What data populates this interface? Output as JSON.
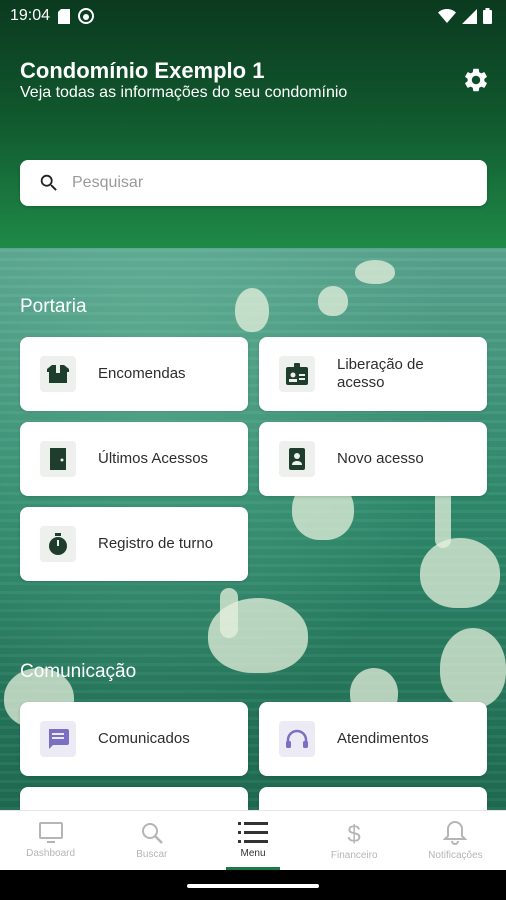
{
  "status_bar": {
    "time": "19:04"
  },
  "header": {
    "title": "Condomínio Exemplo 1",
    "subtitle": "Veja todas as informações do seu condomínio"
  },
  "search": {
    "placeholder": "Pesquisar"
  },
  "sections": {
    "portaria": {
      "title": "Portaria",
      "items": [
        {
          "label": "Encomendas",
          "icon": "package-icon"
        },
        {
          "label": "Liberação de acesso",
          "icon": "id-card-icon"
        },
        {
          "label": "Últimos Acessos",
          "icon": "door-icon"
        },
        {
          "label": "Novo acesso",
          "icon": "badge-icon"
        },
        {
          "label": "Registro de turno",
          "icon": "stopwatch-icon"
        }
      ]
    },
    "comunicacao": {
      "title": "Comunicação",
      "items": [
        {
          "label": "Comunicados",
          "icon": "message-icon"
        },
        {
          "label": "Atendimentos",
          "icon": "headset-icon"
        }
      ]
    }
  },
  "bottom_nav": {
    "items": [
      {
        "label": "Dashboard",
        "icon": "monitor-icon"
      },
      {
        "label": "Buscar",
        "icon": "search-icon"
      },
      {
        "label": "Menu",
        "icon": "menu-icon",
        "active": true
      },
      {
        "label": "Financeiro",
        "icon": "dollar-icon"
      },
      {
        "label": "Notificações",
        "icon": "bell-icon"
      }
    ]
  },
  "colors": {
    "brand_green": "#1e7a45",
    "header_dark": "#0b3a1f",
    "accent_purple": "#7b6fc4"
  }
}
